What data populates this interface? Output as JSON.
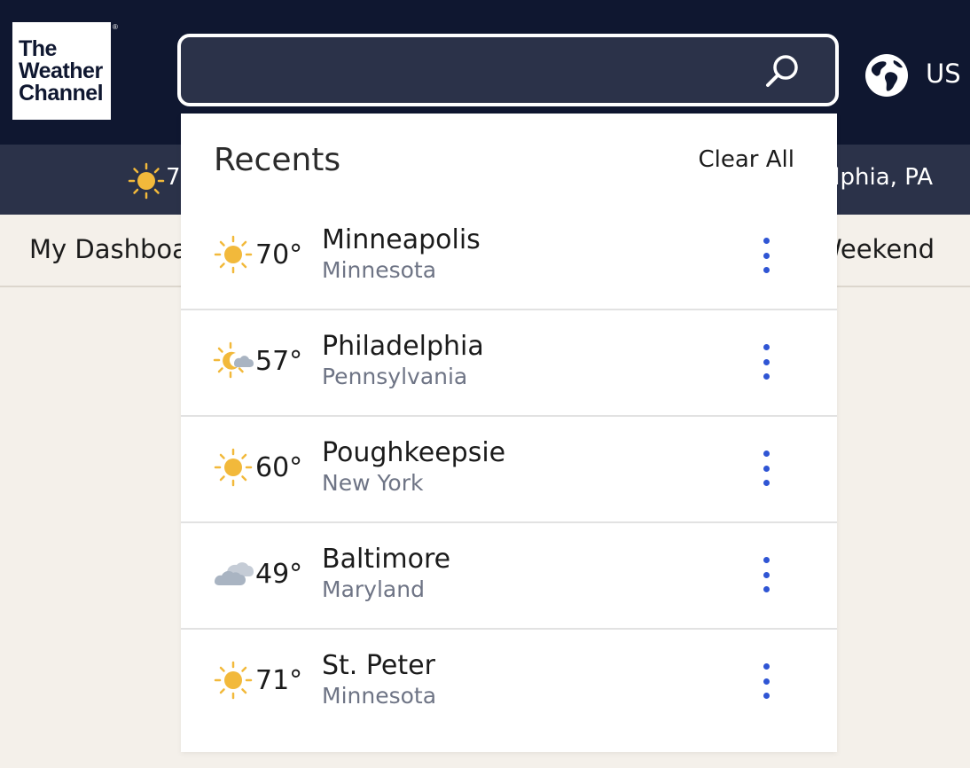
{
  "header": {
    "logo_lines": [
      "The",
      "Weather",
      "Channel"
    ],
    "logo_reg": "®",
    "search_value": "",
    "locale": "US"
  },
  "subbar": {
    "temp": "7",
    "location": "lphia, PA"
  },
  "nav": {
    "left_label": "My Dashboa",
    "right_label": "Weekend"
  },
  "recents": {
    "title": "Recents",
    "clear_label": "Clear All",
    "items": [
      {
        "icon": "sunny-icon",
        "temp": "70°",
        "city": "Minneapolis",
        "region": "Minnesota"
      },
      {
        "icon": "night-partly-cloudy-icon",
        "temp": "57°",
        "city": "Philadelphia",
        "region": "Pennsylvania"
      },
      {
        "icon": "sunny-icon",
        "temp": "60°",
        "city": "Poughkeepsie",
        "region": "New York"
      },
      {
        "icon": "cloudy-icon",
        "temp": "49°",
        "city": "Baltimore",
        "region": "Maryland"
      },
      {
        "icon": "sunny-icon",
        "temp": "71°",
        "city": "St. Peter",
        "region": "Minnesota"
      }
    ]
  },
  "colors": {
    "header_bg": "#0f1730",
    "subbar_bg": "#2b3249",
    "page_bg": "#f4f0ea",
    "sun": "#f2b93b",
    "cloud": "#a9b4c2",
    "accent": "#2f55d4"
  }
}
